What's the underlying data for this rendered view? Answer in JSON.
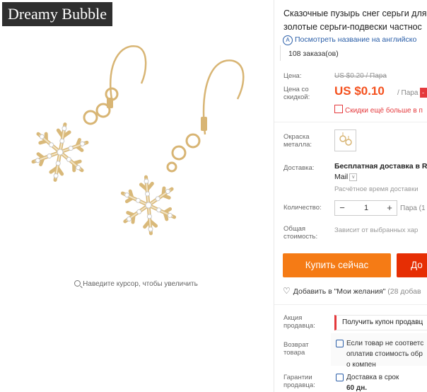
{
  "gallery": {
    "watermark": "Dreamy Bubble",
    "zoom_hint": "Наведите курсор, чтобы увеличить"
  },
  "product": {
    "title_line1": "Сказочные пузырь снег серьги для",
    "title_line2": "золотые серьги-подвески частнос",
    "translate_link": "Посмотреть название на английско",
    "orders": "108 заказа(ов)"
  },
  "pricing": {
    "price_label": "Цена:",
    "old_price": "US $0.20 / Пара",
    "discount_label_1": "Цена со",
    "discount_label_2": "скидкой:",
    "new_price": "US $0.10",
    "per_unit": "/ Пара",
    "badge": "-",
    "promo": "Скидки ещё больше в п"
  },
  "options": {
    "color_label_1": "Окраска",
    "color_label_2": "металла:",
    "shipping_label": "Доставка:",
    "shipping_title": "Бесплатная доставка в Ru",
    "shipping_method": "Mail",
    "shipping_estimate": "Расчётное время доставки",
    "qty_label": "Количество:",
    "qty_minus": "−",
    "qty_value": "1",
    "qty_plus": "+",
    "qty_unit": "Пара (1",
    "total_label_1": "Общая",
    "total_label_2": "стоимость:",
    "total_note": "Зависит от выбранных хар"
  },
  "actions": {
    "buy_now": "Купить сейчас",
    "add_cart": "До",
    "wishlist": "Добавить в \"Мои желания\"",
    "wishlist_count": "(28 добав"
  },
  "seller": {
    "promo_label_1": "Акция",
    "promo_label_2": "продавца:",
    "coupon": "Получить купон продавц",
    "return_label_1": "Возврат",
    "return_label_2": "товара",
    "return_line1": "Если товар не соответс",
    "return_line2": "оплатив стоимость обр",
    "return_line3": "о компен",
    "guarantee_label_1": "Гарантии",
    "guarantee_label_2": "продавца:",
    "guarantee_line1": "Доставка в срок",
    "guarantee_line2": "60 дн."
  },
  "colors": {
    "accent_orange": "#f57b15",
    "accent_red": "#e62e04",
    "price_red": "#f4511e",
    "link_blue": "#2a5ea8"
  }
}
